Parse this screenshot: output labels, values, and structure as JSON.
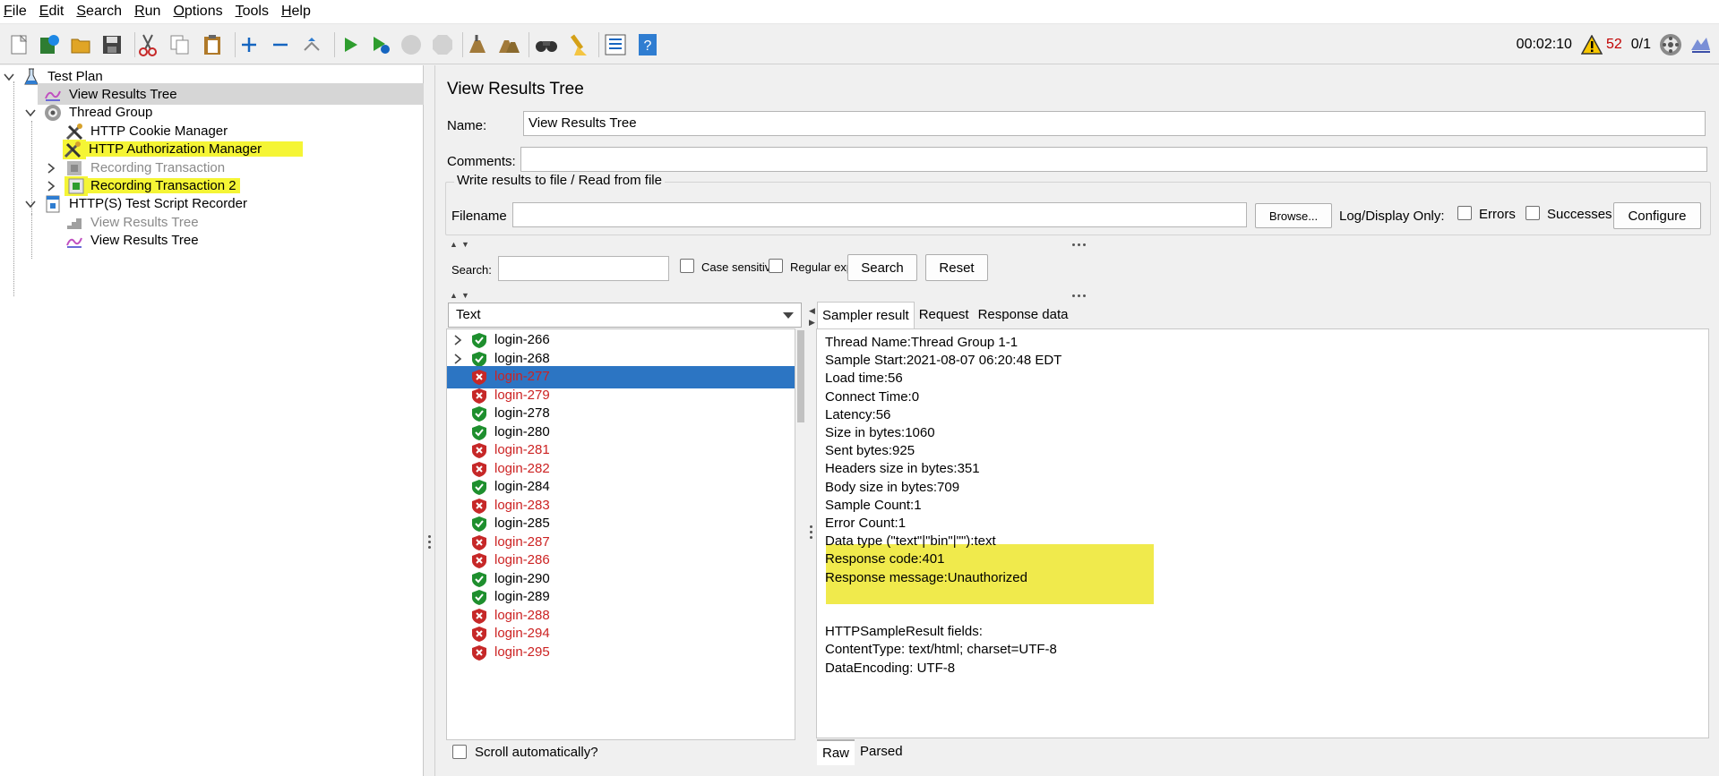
{
  "menu": [
    {
      "key": "F",
      "rest": "ile"
    },
    {
      "key": "E",
      "rest": "dit"
    },
    {
      "key": "S",
      "rest": "earch"
    },
    {
      "key": "R",
      "rest": "un"
    },
    {
      "key": "O",
      "rest": "ptions"
    },
    {
      "key": "T",
      "rest": "ools"
    },
    {
      "key": "H",
      "rest": "elp"
    }
  ],
  "toolbar": {
    "elapsed": "00:02:10",
    "warning_count": "52",
    "threads": "0/1"
  },
  "tree": {
    "test_plan": "Test Plan",
    "view_results_tree_1": "View Results Tree",
    "thread_group": "Thread Group",
    "cookie_manager": "HTTP Cookie Manager",
    "auth_manager": "HTTP Authorization Manager",
    "recording_transaction": "Recording Transaction",
    "recording_transaction_2": "Recording Transaction 2",
    "script_recorder": "HTTP(S) Test Script Recorder",
    "view_results_tree_2": "View Results Tree",
    "view_results_tree_3": "View Results Tree"
  },
  "panel": {
    "title": "View Results Tree",
    "name_label": "Name:",
    "name_value": "View Results Tree",
    "comments_label": "Comments:",
    "comments_value": "",
    "file_group": "Write results to file / Read from file",
    "filename_label": "Filename",
    "filename_value": "",
    "browse": "Browse...",
    "log_display_only": "Log/Display Only:",
    "errors": "Errors",
    "successes": "Successes",
    "configure": "Configure",
    "search_label": "Search:",
    "search_value": "",
    "case_sensitive": "Case sensitive",
    "regular_exp": "Regular exp.",
    "search_btn": "Search",
    "reset_btn": "Reset",
    "renderer": "Text",
    "scroll_auto": "Scroll automatically?"
  },
  "results": [
    {
      "label": "login-266",
      "status": "ok",
      "expandable": true
    },
    {
      "label": "login-268",
      "status": "ok",
      "expandable": true
    },
    {
      "label": "login-277",
      "status": "fail",
      "expandable": false
    },
    {
      "label": "login-279",
      "status": "fail",
      "expandable": false
    },
    {
      "label": "login-278",
      "status": "ok",
      "expandable": false
    },
    {
      "label": "login-280",
      "status": "ok",
      "expandable": false
    },
    {
      "label": "login-281",
      "status": "fail",
      "expandable": false
    },
    {
      "label": "login-282",
      "status": "fail",
      "expandable": false
    },
    {
      "label": "login-284",
      "status": "ok",
      "expandable": false
    },
    {
      "label": "login-283",
      "status": "fail",
      "expandable": false
    },
    {
      "label": "login-285",
      "status": "ok",
      "expandable": false
    },
    {
      "label": "login-287",
      "status": "fail",
      "expandable": false
    },
    {
      "label": "login-286",
      "status": "fail",
      "expandable": false
    },
    {
      "label": "login-290",
      "status": "ok",
      "expandable": false
    },
    {
      "label": "login-289",
      "status": "ok",
      "expandable": false
    },
    {
      "label": "login-288",
      "status": "fail",
      "expandable": false
    },
    {
      "label": "login-294",
      "status": "fail",
      "expandable": false
    },
    {
      "label": "login-295",
      "status": "fail",
      "expandable": false
    }
  ],
  "detail": {
    "tabs": [
      "Sampler result",
      "Request",
      "Response data"
    ],
    "lines": [
      "Thread Name:Thread Group 1-1",
      "Sample Start:2021-08-07 06:20:48 EDT",
      "Load time:56",
      "Connect Time:0",
      "Latency:56",
      "Size in bytes:1060",
      "Sent bytes:925",
      "Headers size in bytes:351",
      "Body size in bytes:709",
      "Sample Count:1",
      "Error Count:1",
      "Data type (\"text\"|\"bin\"|\"\"):text",
      "Response code:401",
      "Response message:Unauthorized",
      "",
      "",
      "HTTPSampleResult fields:",
      "ContentType: text/html; charset=UTF-8",
      "DataEncoding: UTF-8"
    ],
    "bottom_tabs": [
      "Raw",
      "Parsed"
    ]
  },
  "colors": {
    "selection": "#2c75c3",
    "highlight": "#f5f535",
    "fail_text": "#cc2222"
  }
}
